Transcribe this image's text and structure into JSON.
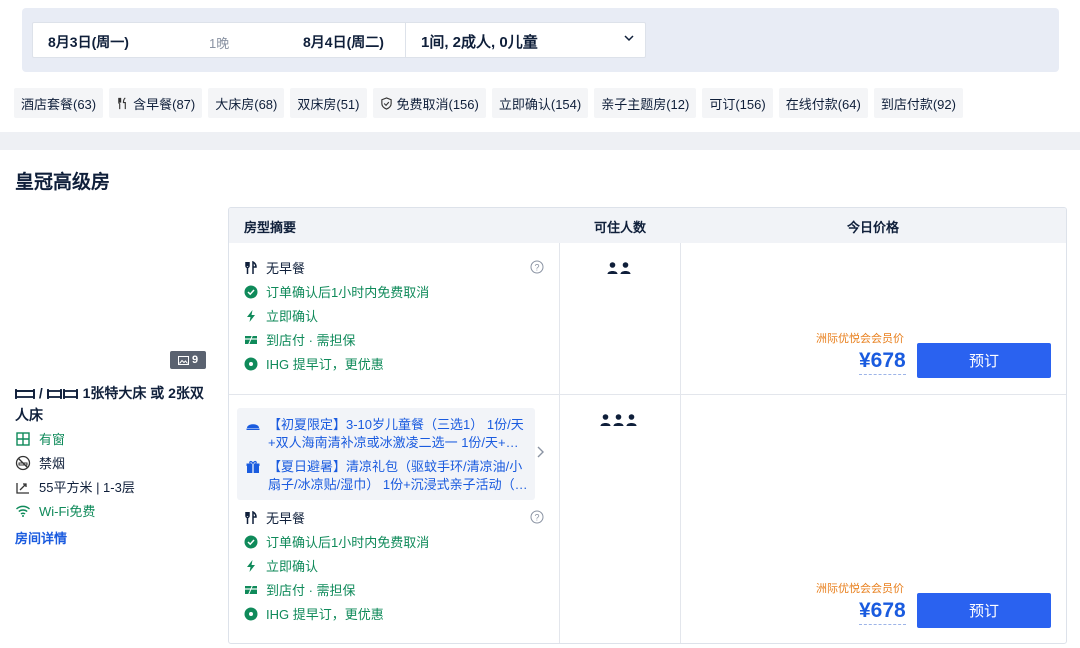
{
  "search": {
    "checkin": "8月3日(周一)",
    "nights": "1晚",
    "checkout": "8月4日(周二)",
    "guests": "1间, 2成人, 0儿童"
  },
  "filters": [
    {
      "label": "酒店套餐(63)",
      "icon": ""
    },
    {
      "label": "含早餐(87)",
      "icon": "utensils-icon"
    },
    {
      "label": "大床房(68)",
      "icon": ""
    },
    {
      "label": "双床房(51)",
      "icon": ""
    },
    {
      "label": "免费取消(156)",
      "icon": "shield-check-icon"
    },
    {
      "label": "立即确认(154)",
      "icon": ""
    },
    {
      "label": "亲子主题房(12)",
      "icon": ""
    },
    {
      "label": "可订(156)",
      "icon": ""
    },
    {
      "label": "在线付款(64)",
      "icon": ""
    },
    {
      "label": "到店付款(92)",
      "icon": ""
    }
  ],
  "room": {
    "name": "皇冠高级房",
    "photo_count": "9",
    "bed_separator": "/",
    "bed_desc": "1张特大床 或 2张双人床",
    "window": "有窗",
    "smoking": "禁烟",
    "size_floor": "55平方米 | 1-3层",
    "wifi": "Wi-Fi免费",
    "detail_link": "房间详情"
  },
  "table": {
    "col_summary": "房型摘要",
    "col_occupancy": "可住人数",
    "col_price": "今日价格"
  },
  "offers": [
    {
      "meal": "无早餐",
      "cancel": "订单确认后1小时内免费取消",
      "confirm": "立即确认",
      "payment": "到店付 · 需担保",
      "promo": "IHG 提早订，更优惠",
      "occupancy": 2,
      "member_label": "洲际优悦会会员价",
      "price": "¥678",
      "book": "预订"
    },
    {
      "perk1": "【初夏限定】3-10岁儿童餐（三选1） 1份/天+双人海南清补凉或冰激凌二选一 1份/天+…",
      "perk2": "【夏日避暑】清凉礼包（驱蚊手环/清凉油/小扇子/冰凉贴/湿巾） 1份+沉浸式亲子活动（…",
      "meal": "无早餐",
      "cancel": "订单确认后1小时内免费取消",
      "confirm": "立即确认",
      "payment": "到店付 · 需担保",
      "promo": "IHG 提早订，更优惠",
      "occupancy": 3,
      "member_label": "洲际优悦会会员价",
      "price": "¥678",
      "book": "预订"
    }
  ],
  "colors": {
    "accent": "#2a62f0",
    "green": "#0f8a5a",
    "orange": "#e87f1c"
  }
}
